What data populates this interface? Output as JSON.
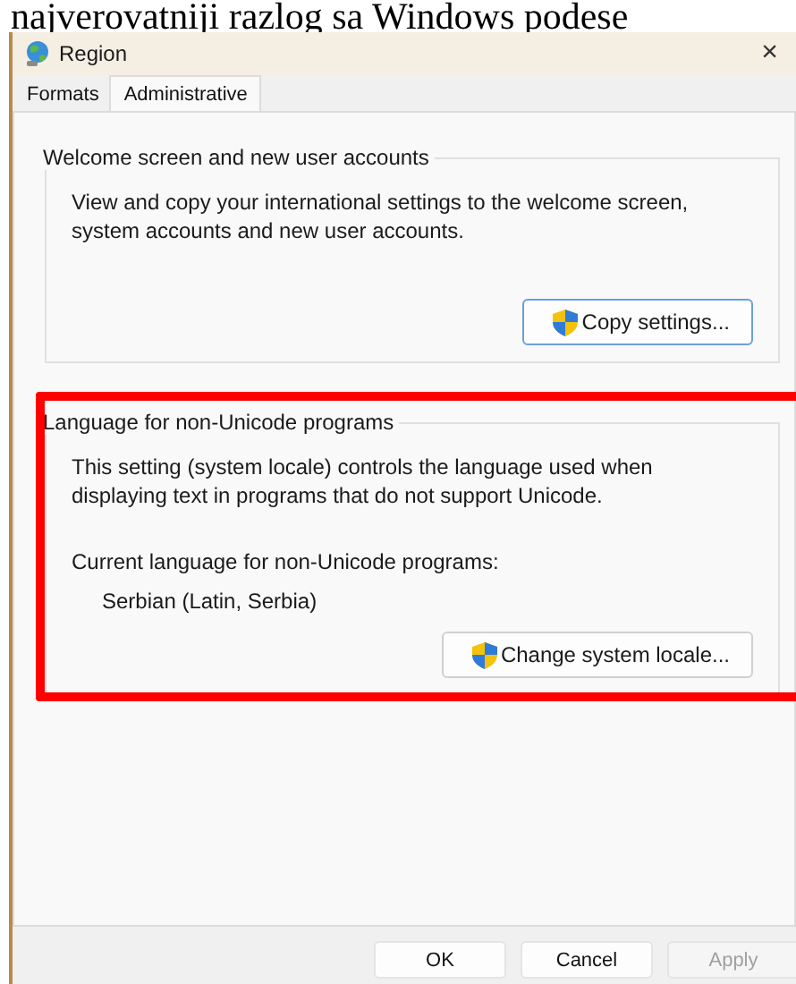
{
  "page_text": "najverovatniji razlog sa Windows podese",
  "window": {
    "title": "Region",
    "close": "×"
  },
  "tabs": [
    {
      "label": "Formats",
      "selected": false
    },
    {
      "label": "Administrative",
      "selected": true
    }
  ],
  "groups": [
    {
      "title": "Welcome screen and new user accounts",
      "description": "View and copy your international settings to the welcome screen, system accounts and new user accounts.",
      "button": "Copy settings...",
      "highlighted": false
    },
    {
      "title": "Language for non-Unicode programs",
      "description": "This setting (system locale) controls the language used when displaying text in programs that do not support Unicode.",
      "current_label": "Current language for non-Unicode programs:",
      "current_value": "Serbian (Latin, Serbia)",
      "button": "Change system locale...",
      "highlighted": true
    }
  ],
  "buttons": [
    {
      "label": "OK",
      "disabled": false
    },
    {
      "label": "Cancel",
      "disabled": false
    },
    {
      "label": "Apply",
      "disabled": true
    }
  ]
}
